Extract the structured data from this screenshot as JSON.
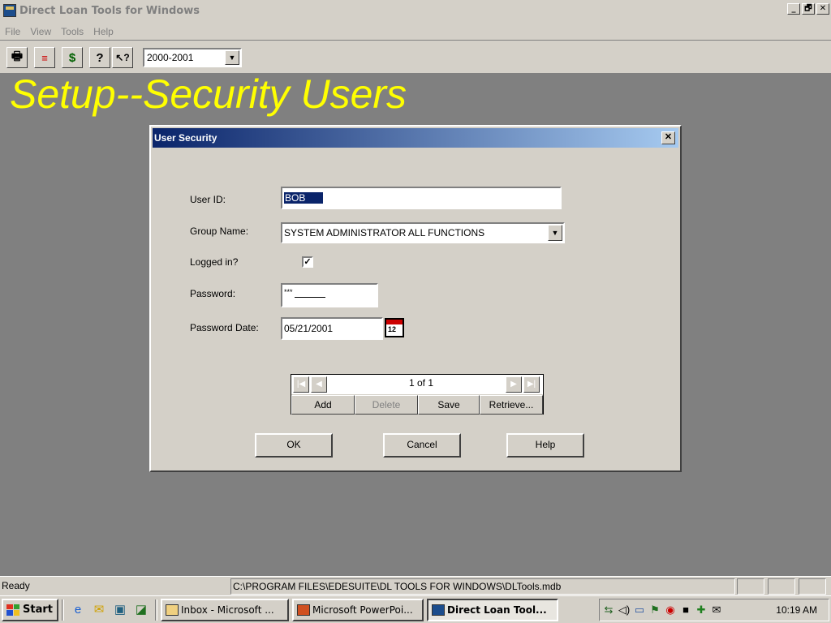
{
  "window": {
    "title": "Direct Loan Tools for Windows",
    "controls": [
      "_",
      "🗗",
      "✕"
    ]
  },
  "menu": [
    "File",
    "View",
    "Tools",
    "Help"
  ],
  "toolbar": {
    "icons": [
      "printer-icon",
      "loan-icon",
      "dollar-icon",
      "help-icon",
      "context-help-icon"
    ],
    "year_select": "2000-2001"
  },
  "slide_title": "Setup--Security Users",
  "dialog": {
    "title": "User Security",
    "user_id_label": "User ID:",
    "user_id_value": "BOB",
    "group_name_label": "Group Name:",
    "group_name_value": "SYSTEM ADMINISTRATOR ALL FUNCTIONS",
    "logged_in_label": "Logged in?",
    "logged_in_checked": true,
    "password_label": "Password:",
    "password_value": "***",
    "password_date_label": "Password Date:",
    "password_date_value": "05/21/2001",
    "navigator": {
      "position": "1 of 1",
      "add": "Add",
      "delete": "Delete",
      "save": "Save",
      "retrieve": "Retrieve..."
    },
    "ok_button": "OK",
    "cancel_button": "Cancel",
    "help_button": "Help"
  },
  "statusbar": {
    "status": "Ready",
    "path": "C:\\PROGRAM FILES\\EDESUITE\\DL TOOLS FOR WINDOWS\\DLTools.mdb"
  },
  "taskbar": {
    "start": "Start",
    "tasks": [
      {
        "label": "Inbox - Microsoft ...",
        "active": false
      },
      {
        "label": "Microsoft PowerPoi...",
        "active": false
      },
      {
        "label": "Direct Loan Tool...",
        "active": true
      }
    ],
    "clock": "10:19 AM"
  },
  "colors": {
    "title_text": "#ffff00",
    "dialog_title_start": "#0a246a",
    "dialog_title_end": "#a6caf0",
    "desktop": "#808080"
  }
}
